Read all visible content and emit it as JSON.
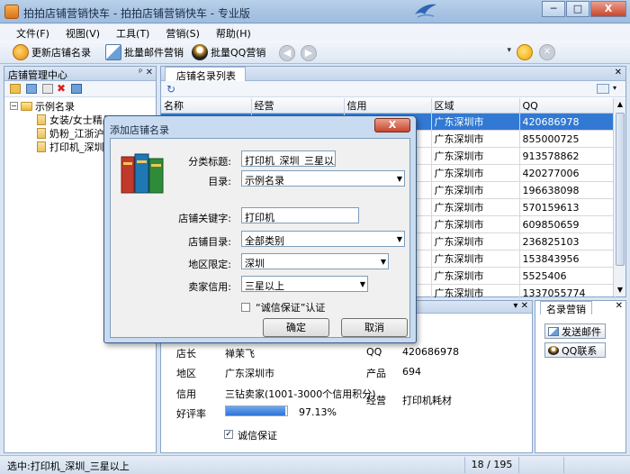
{
  "window": {
    "title": "拍拍店铺营销快车 - 拍拍店铺营销快车 - 专业版",
    "btn_min": "─",
    "btn_max": "□",
    "btn_close": "X"
  },
  "menu": [
    "文件(F)",
    "视图(V)",
    "工具(T)",
    "营销(S)",
    "帮助(H)"
  ],
  "toolbar": {
    "refresh_label": "更新店铺名录",
    "mail_label": "批量邮件营销",
    "qq_label": "批量QQ营销"
  },
  "left_panel": {
    "title": "店铺管理中心",
    "pin": "ᵖ ✕",
    "tree": [
      {
        "label": "示例名录",
        "level": 0
      },
      {
        "label": "女装/女士精品_江西",
        "level": 1
      },
      {
        "label": "奶粉_江浙沪",
        "level": 1
      },
      {
        "label": "打印机_深圳",
        "level": 1
      }
    ]
  },
  "list_panel": {
    "tab": "店铺名录列表",
    "close": "✕",
    "columns": [
      "名称",
      "经营",
      "信用",
      "区域",
      "QQ"
    ],
    "rows": [
      {
        "region": "广东深圳市",
        "qq": "420686978"
      },
      {
        "region": "广东深圳市",
        "qq": "855000725"
      },
      {
        "region": "广东深圳市",
        "qq": "913578862"
      },
      {
        "region": "广东深圳市",
        "qq": "420277006"
      },
      {
        "region": "广东深圳市",
        "qq": "196638098"
      },
      {
        "region": "广东深圳市",
        "qq": "570159613"
      },
      {
        "region": "广东深圳市",
        "qq": "609850659"
      },
      {
        "region": "广东深圳市",
        "qq": "236825103"
      },
      {
        "region": "广东深圳市",
        "qq": "153843956"
      },
      {
        "region": "广东深圳市",
        "qq": "5525406"
      },
      {
        "region": "广东深圳市",
        "qq": "1337055774"
      }
    ]
  },
  "detail": {
    "owner_label": "店长",
    "owner_value": "禅茉飞",
    "qq_label": "QQ",
    "qq_value": "420686978",
    "region_label": "地区",
    "region_value": "广东深圳市",
    "product_label": "产品",
    "product_value": "694",
    "credit_label": "信用",
    "credit_value": "三钻卖家(1001-3000个信用积分)",
    "business_label": "经营",
    "business_value": "打印机耗材",
    "rating_label": "好评率",
    "rating_value": "97.13%",
    "rating_fraction": 0.9713,
    "guarantee_label": "诚信保证",
    "close": "▾ ✕"
  },
  "side_panel": {
    "tab": "名录营销",
    "close": "✕",
    "send_mail": "发送邮件",
    "qq_contact": "QQ联系"
  },
  "dialog": {
    "title": "添加店铺名录",
    "close": "X",
    "category_label": "分类标题:",
    "category_value": "打印机_深圳_三星以上",
    "dir_label": "目录:",
    "dir_value": "示例名录",
    "keyword_label": "店铺关键字:",
    "keyword_value": "打印机",
    "shopdir_label": "店铺目录:",
    "shopdir_value": "全部类别",
    "area_label": "地区限定:",
    "area_value": "深圳",
    "credit_label": "卖家信用:",
    "credit_value": "三星以上",
    "guarantee_label": "“诚信保证”认证",
    "ok": "确定",
    "cancel": "取消"
  },
  "status": {
    "text": "选中:打印机_深圳_三星以上",
    "page": "18 / 195"
  }
}
